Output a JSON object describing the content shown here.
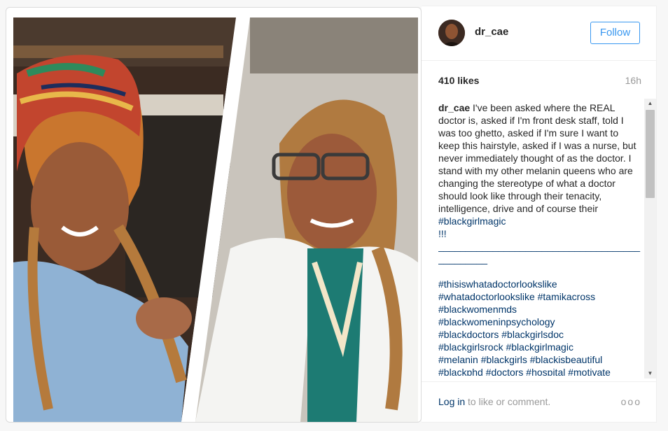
{
  "header": {
    "username": "dr_cae",
    "follow_label": "Follow"
  },
  "stats": {
    "likes": "410 likes",
    "time": "16h"
  },
  "caption": {
    "user": "dr_cae",
    "body": " I've been asked where the REAL doctor is, asked if I'm front desk staff, told I was too ghetto, asked if I'm sure I want to keep this hairstyle, asked if I was a nurse, but never immediately thought of as the doctor. I stand with my other melanin queens who are changing the stereotype of what a doctor should look like through their tenacity, intelligence, drive and of course their ",
    "inline_tag": "#blackgirlmagic",
    "tail": "\n!!!\n______________________________________________\n\n#thisiswhatadoctorlookslike\n#whatadoctorlookslike #tamikacross\n#blackwomenmds\n#blackwomeninpsychology\n#blackdoctors #blackgirlsdoc\n#blackgirlsrock #blackgirlmagic\n#melanin #blackgirls #blackisbeautiful\n#blackphd #doctors #hospital #motivate\n#motivation #educate #education"
  },
  "footer": {
    "login_link": "Log in",
    "login_rest": " to like or comment.",
    "more": "ooo"
  },
  "colors": {
    "link_blue": "#003569",
    "button_blue": "#3897f0",
    "muted": "#999999"
  },
  "icons": {
    "scroll_up": "triangle-up",
    "scroll_down": "triangle-down"
  }
}
